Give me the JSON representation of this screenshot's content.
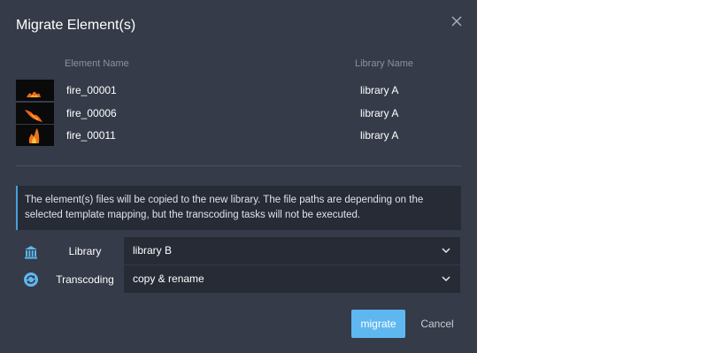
{
  "dialog": {
    "title": "Migrate Element(s)",
    "close_icon": "close-icon"
  },
  "table": {
    "headers": {
      "element": "Element Name",
      "library": "Library Name"
    },
    "rows": [
      {
        "name": "fire_00001",
        "library": "library A",
        "thumbnail": "fire-thumbnail"
      },
      {
        "name": "fire_00006",
        "library": "library A",
        "thumbnail": "fire-thumbnail"
      },
      {
        "name": "fire_00011",
        "library": "library A",
        "thumbnail": "fire-thumbnail"
      }
    ]
  },
  "info": {
    "text": "The element(s) files will be copied to the new library. The file paths are depending on the selected template mapping, but the transcoding tasks will not be executed."
  },
  "form": {
    "library": {
      "label": "Library",
      "value": "library B",
      "icon": "library-icon"
    },
    "transcoding": {
      "label": "Transcoding",
      "value": "copy & rename",
      "icon": "transcoding-icon"
    }
  },
  "buttons": {
    "migrate": "migrate",
    "cancel": "Cancel"
  },
  "colors": {
    "dialog_bg": "#353b48",
    "field_bg": "#262b36",
    "accent": "#5fb7f0",
    "info_border": "#4a9fd8"
  }
}
